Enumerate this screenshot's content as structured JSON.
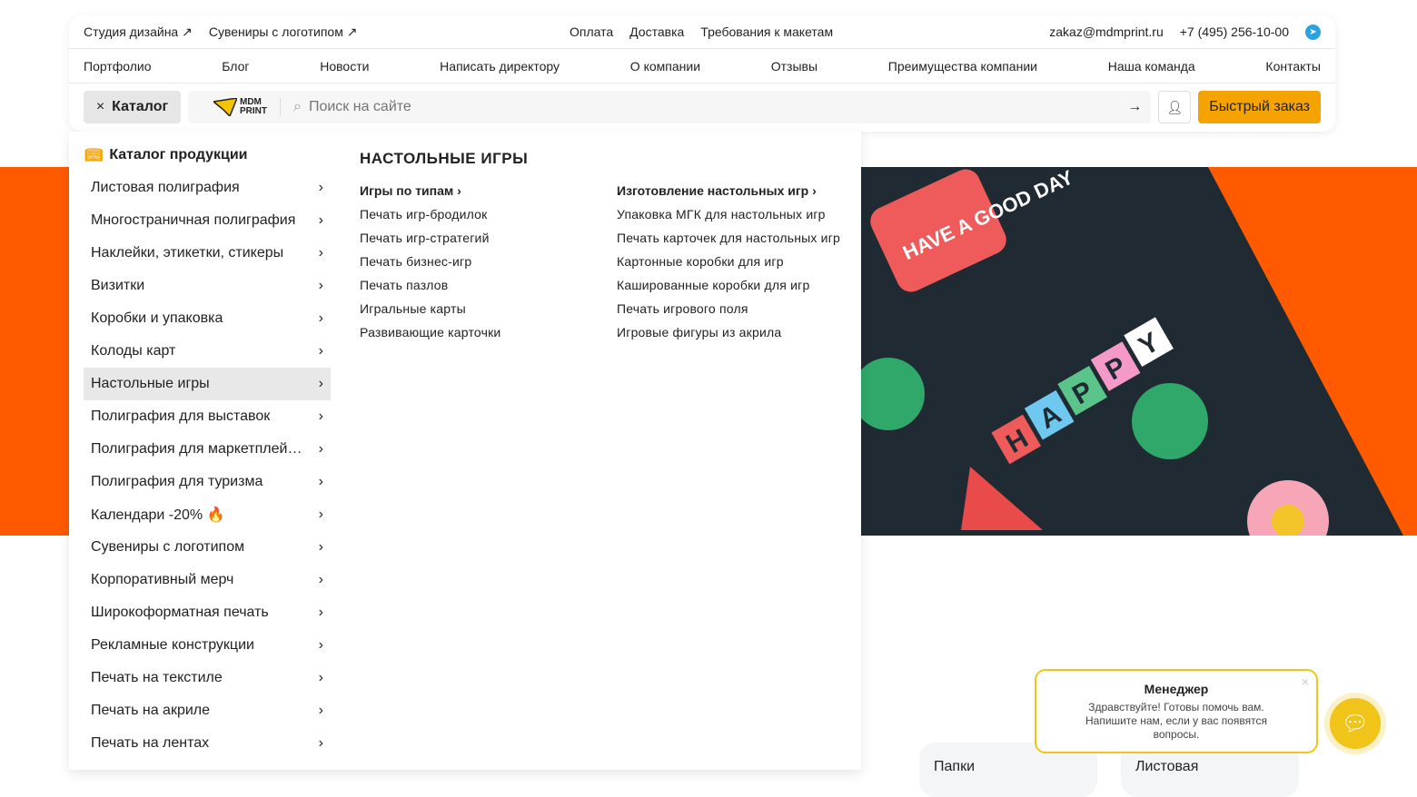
{
  "topbar": {
    "left": [
      {
        "label": "Студия дизайна",
        "icon": "arrow-up-right-icon"
      },
      {
        "label": "Сувениры с логотипом",
        "icon": "arrow-up-right-icon"
      }
    ],
    "center": [
      "Оплата",
      "Доставка",
      "Требования к макетам"
    ],
    "email": "zakaz@mdmprint.ru",
    "phone": "+7 (495) 256-10-00"
  },
  "nav": [
    "Портфолио",
    "Блог",
    "Новости",
    "Написать директору",
    "О компании",
    "Отзывы",
    "Преимущества компании",
    "Наша команда",
    "Контакты"
  ],
  "toolbar": {
    "catalog_label": "Каталог",
    "logo_text": "MDM PRINT",
    "search_placeholder": "Поиск на сайте",
    "quick_order": "Быстрый заказ"
  },
  "catalog": {
    "title": "Каталог продукции",
    "items": [
      "Листовая полиграфия",
      "Многостраничная полиграфия",
      "Наклейки, этикетки, стикеры",
      "Визитки",
      "Коробки и упаковка",
      "Колоды карт",
      "Настольные игры",
      "Полиграфия для выставок",
      "Полиграфия для маркетплей…",
      "Полиграфия для туризма",
      "Календари -20% 🔥",
      "Сувениры с логотипом",
      "Корпоративный мерч",
      "Широкоформатная печать",
      "Рекламные конструкции",
      "Печать на текстиле",
      "Печать на акриле",
      "Печать на лентах"
    ],
    "active_index": 6
  },
  "submenu": {
    "title": "НАСТОЛЬНЫЕ ИГРЫ",
    "columns": [
      {
        "heading": "Игры по типам",
        "links": [
          "Печать игр-бродилок",
          "Печать игр-стратегий",
          "Печать бизнес-игр",
          "Печать пазлов",
          "Игральные карты",
          "Развивающие карточки"
        ]
      },
      {
        "heading": "Изготовление настольных игр",
        "links": [
          "Упаковка МГК для настольных игр",
          "Печать карточек для настольных игр",
          "Картонные коробки для игр",
          "Кашированные коробки для игр",
          "Печать игрового поля",
          "Игровые фигуры из акрила"
        ]
      }
    ]
  },
  "hero": {
    "sticker_text": [
      "HAVE A GOOD DAY",
      "HAPPY"
    ]
  },
  "cards": [
    "Папки",
    "Листовая"
  ],
  "chat": {
    "title": "Менеджер",
    "message": "Здравствуйте! Готовы помочь вам. Напишите нам, если у вас появятся вопросы."
  },
  "colors": {
    "accent": "#f5a300",
    "hero_orange": "#ff5a00",
    "chat_yellow": "#f0c419"
  }
}
